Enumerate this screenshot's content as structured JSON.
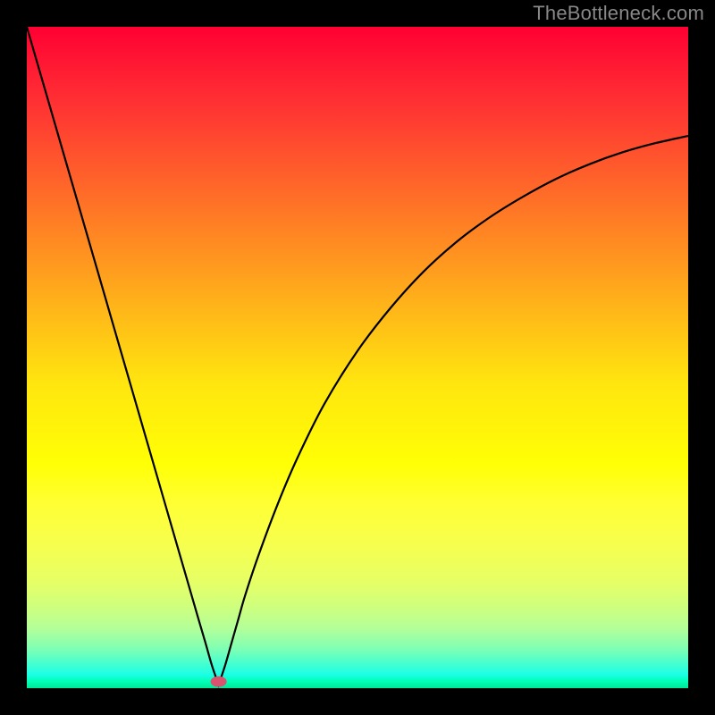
{
  "watermark": "TheBottleneck.com",
  "chart_data": {
    "type": "line",
    "title": "",
    "xlabel": "",
    "ylabel": "",
    "xlim": [
      0,
      100
    ],
    "ylim": [
      0,
      100
    ],
    "grid": false,
    "legend": false,
    "marker": {
      "x": 29,
      "y": 1,
      "color": "#d9536f"
    },
    "background_gradient_top": "#ff0033",
    "background_gradient_bottom": "#00e699",
    "series": [
      {
        "name": "curve",
        "color": "#000000",
        "x": [
          0,
          2,
          4,
          6,
          8,
          10,
          12,
          14,
          16,
          18,
          20,
          22,
          24,
          26,
          27,
          28,
          29,
          30,
          31,
          32,
          33,
          35,
          38,
          41,
          45,
          50,
          55,
          60,
          65,
          70,
          75,
          80,
          85,
          90,
          95,
          100
        ],
        "y": [
          100,
          93.1,
          86.2,
          79.3,
          72.4,
          65.5,
          58.6,
          51.7,
          44.8,
          37.9,
          31.0,
          24.1,
          17.2,
          10.3,
          6.9,
          3.4,
          0.5,
          3.5,
          7.0,
          10.5,
          14.0,
          20.0,
          28.0,
          35.0,
          43.0,
          51.0,
          57.5,
          63.0,
          67.5,
          71.2,
          74.3,
          77.0,
          79.2,
          81.0,
          82.4,
          83.5
        ]
      }
    ]
  }
}
